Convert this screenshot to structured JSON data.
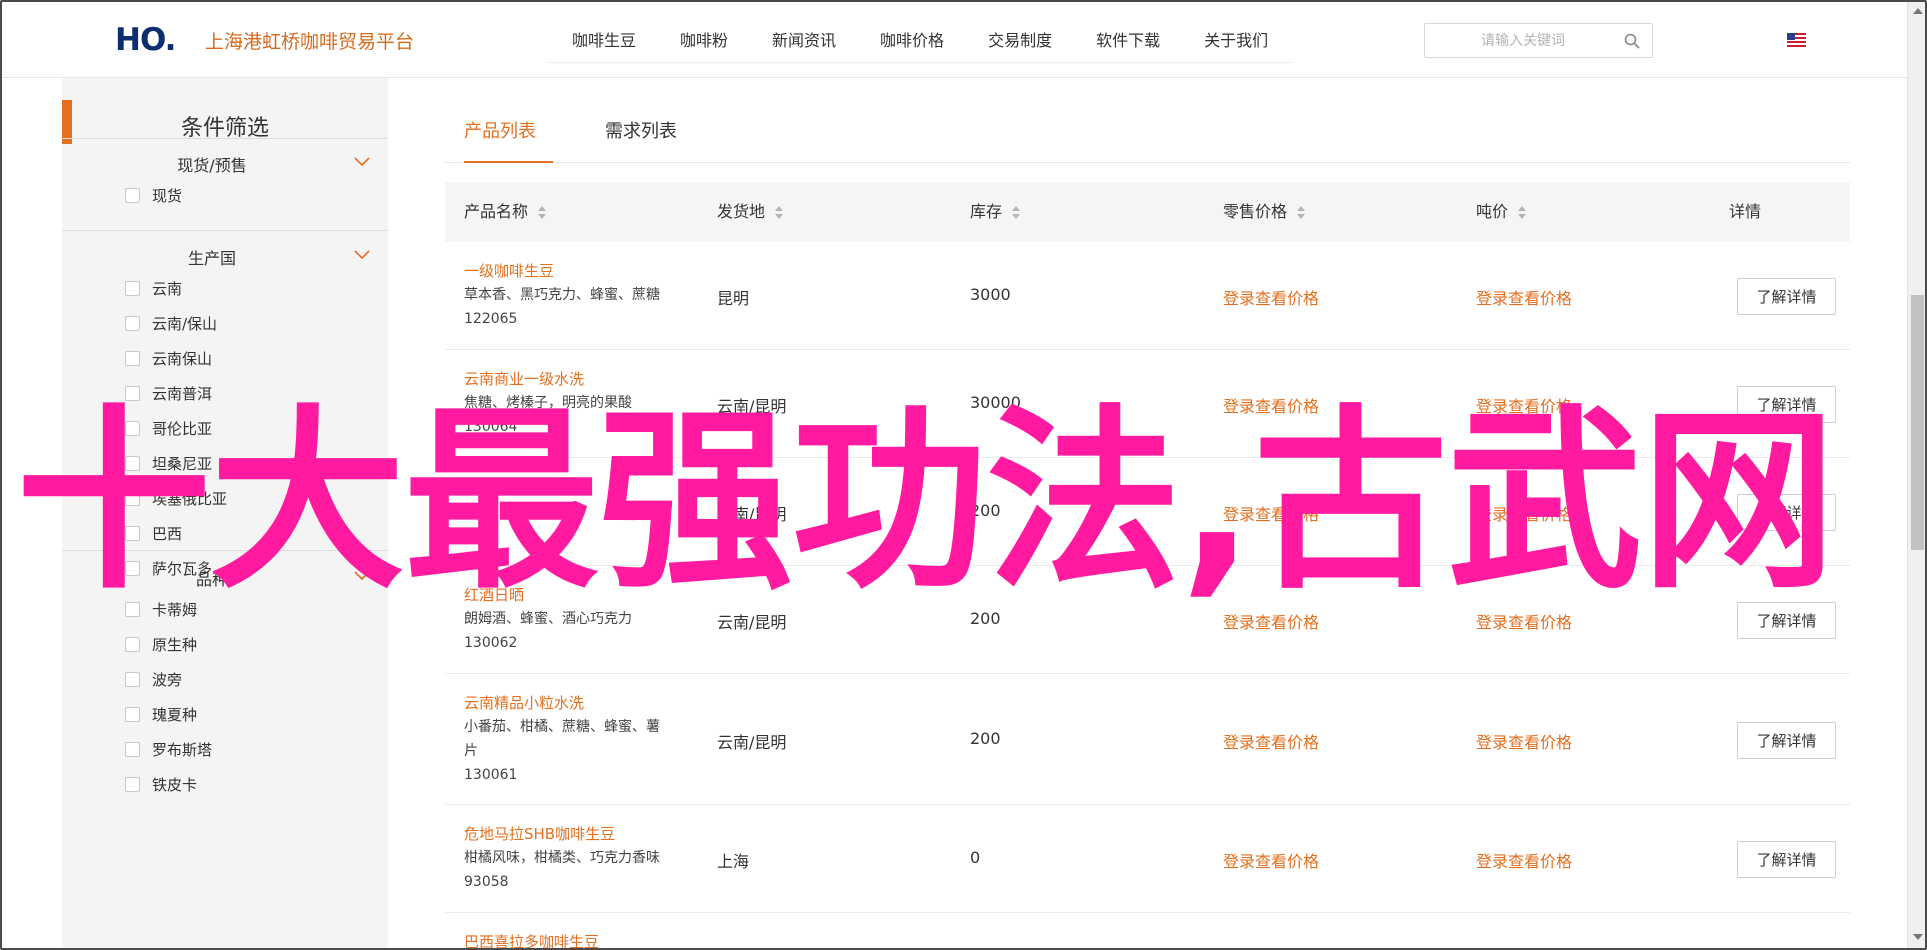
{
  "header": {
    "logo_text": "HO.",
    "site_name": "上海港虹桥咖啡贸易平台",
    "nav": [
      "咖啡生豆",
      "咖啡粉",
      "新闻资讯",
      "咖啡价格",
      "交易制度",
      "软件下载",
      "关于我们"
    ],
    "search_placeholder": "请输入关键词",
    "search_icon": "search-icon",
    "language_flag": "us-flag-icon"
  },
  "sidebar": {
    "title": "条件筛选",
    "groups": [
      {
        "title": "现货/预售",
        "options": [
          "现货"
        ]
      },
      {
        "title": "生产国",
        "options": [
          "云南",
          "云南/保山",
          "云南保山",
          "云南普洱",
          "哥伦比亚",
          "坦桑尼亚",
          "埃塞俄比亚",
          "巴西",
          "萨尔瓦多"
        ]
      },
      {
        "title": "品种",
        "options": [
          "卡蒂姆",
          "原生种",
          "波旁",
          "瑰夏种",
          "罗布斯塔",
          "铁皮卡"
        ]
      }
    ]
  },
  "tabs": [
    "产品列表",
    "需求列表"
  ],
  "table": {
    "headers": [
      "产品名称",
      "发货地",
      "库存",
      "零售价格",
      "吨价",
      "详情"
    ],
    "price_link_text": "登录查看价格",
    "detail_button": "了解详情",
    "rows": [
      {
        "title": "一级咖啡生豆",
        "desc": [
          "草本香、黑巧克力、蜂蜜、蔗糖"
        ],
        "code": "122065",
        "origin": "昆明",
        "stock": "3000"
      },
      {
        "title": "云南商业一级水洗",
        "desc": [
          "焦糖、烤榛子，明亮的果酸"
        ],
        "code": "130064",
        "origin": "云南/昆明",
        "stock": "30000"
      },
      {
        "title": "",
        "desc": [
          "",
          ""
        ],
        "code": "",
        "origin": "云南/昆明",
        "stock": "200"
      },
      {
        "title": "红酒日晒",
        "desc": [
          "朗姆酒、蜂蜜、酒心巧克力"
        ],
        "code": "130062",
        "origin": "云南/昆明",
        "stock": "200"
      },
      {
        "title": "云南精品小粒水洗",
        "desc": [
          "小番茄、柑橘、蔗糖、蜂蜜、薯",
          "片"
        ],
        "code": "130061",
        "origin": "云南/昆明",
        "stock": "200"
      },
      {
        "title": "危地马拉SHB咖啡生豆",
        "desc": [
          "柑橘风味，柑橘类、巧克力香味"
        ],
        "code": "93058",
        "origin": "上海",
        "stock": "0"
      },
      {
        "title": "巴西喜拉多咖啡生豆",
        "desc": [],
        "code": "",
        "origin": "",
        "stock": ""
      }
    ]
  },
  "overlay_text": "十大最强功法,古武网",
  "colors": {
    "accent": "#e46f1e",
    "overlay": "#ff1aa0",
    "brand_blue": "#0d2e6e"
  }
}
